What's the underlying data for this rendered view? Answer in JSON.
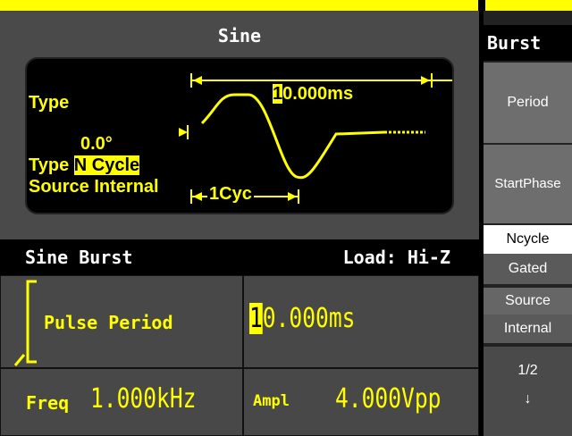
{
  "wave_title": "Sine",
  "waveform": {
    "type_label": "Type",
    "period": "10.000ms",
    "period_cursor_char": "1",
    "period_rest": "0.000ms",
    "start_phase": "0.0°",
    "type_prefix": "Type",
    "type_value": "N Cycle",
    "source_text": "Source Internal",
    "cycles_label": "1Cyc"
  },
  "burst_header": {
    "title": "Sine Burst",
    "load": "Load: Hi-Z"
  },
  "params": {
    "pulse_period_label": "Pulse Period",
    "pulse_period_cursor": "1",
    "pulse_period_rest": "0.000ms",
    "freq_label": "Freq",
    "freq_value": "1.000kHz",
    "ampl_label": "Ampl",
    "ampl_value": "4.000Vpp"
  },
  "softkeys": {
    "title": "Burst",
    "period": "Period",
    "start_phase": "StartPhase",
    "ncycle": "Ncycle",
    "gated": "Gated",
    "source": "Source",
    "internal": "Internal",
    "page": "1/2",
    "page_arrow": "↓"
  },
  "colors": {
    "accent": "#ffff00",
    "panel": "#4a4a4a",
    "background": "#000000"
  }
}
